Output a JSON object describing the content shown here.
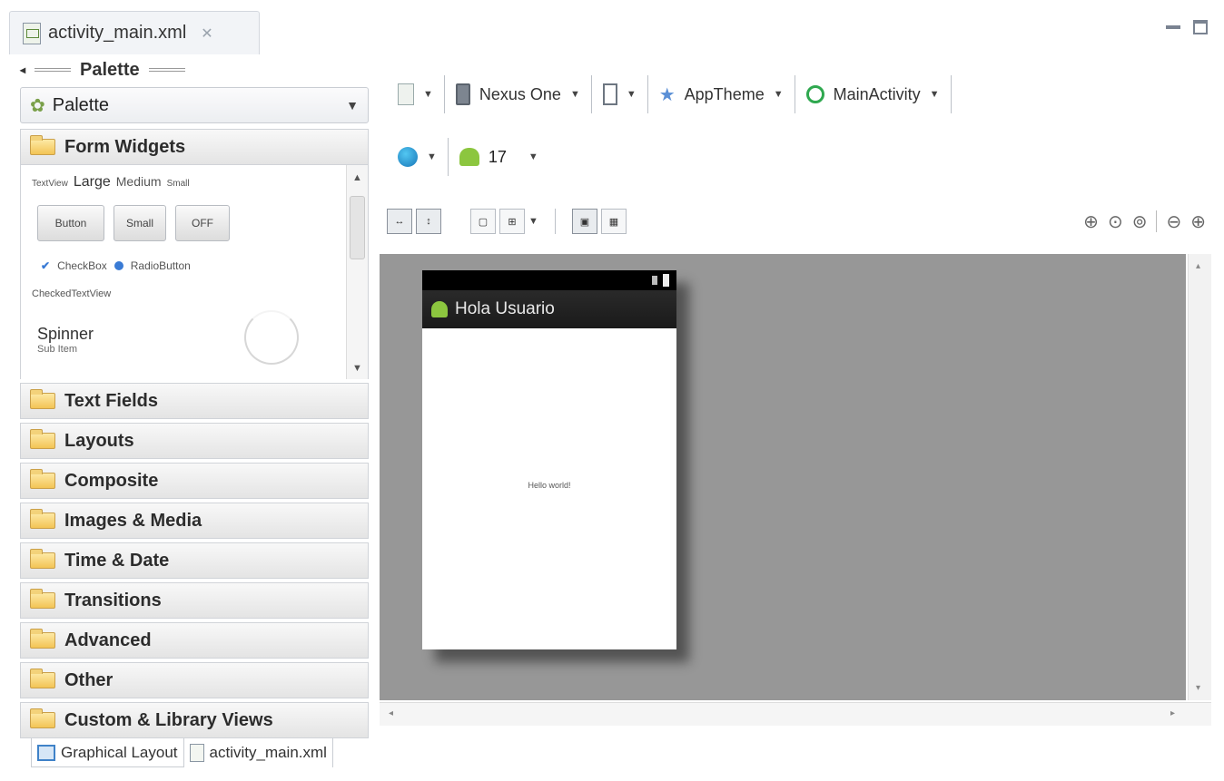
{
  "editor_tab": {
    "title": "activity_main.xml",
    "close": "✕"
  },
  "palette": {
    "header": "Palette",
    "dropdown_label": "Palette",
    "open_category": "Form Widgets",
    "widgets": {
      "textview": "TextView",
      "large": "Large",
      "medium": "Medium",
      "small": "Small",
      "button": "Button",
      "small_button": "Small",
      "toggle": "OFF",
      "checkbox": "CheckBox",
      "radiobutton": "RadioButton",
      "checked_textview": "CheckedTextView",
      "spinner": "Spinner",
      "spinner_sub": "Sub Item"
    },
    "categories": [
      "Text Fields",
      "Layouts",
      "Composite",
      "Images & Media",
      "Time & Date",
      "Transitions",
      "Advanced",
      "Other",
      "Custom & Library Views"
    ]
  },
  "toolbar": {
    "device": "Nexus One",
    "theme": "AppTheme",
    "activity": "MainActivity",
    "api_level": "17"
  },
  "device_preview": {
    "app_title": "Hola Usuario",
    "content_text": "Hello world!"
  },
  "bottom_tabs": [
    "Graphical Layout",
    "activity_main.xml"
  ]
}
